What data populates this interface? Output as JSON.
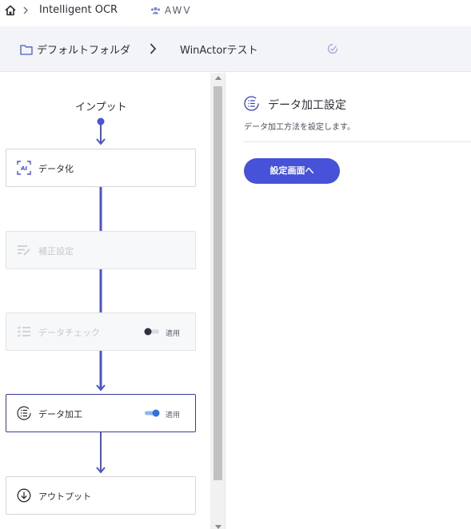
{
  "topbar": {
    "app_name": "Intelligent OCR",
    "org_name": "AWV"
  },
  "breadcrumb": {
    "folder": "デフォルトフォルダ",
    "project": "WinActorテスト"
  },
  "flow": {
    "input_label": "インプット",
    "nodes": [
      {
        "label": "データ化",
        "icon": "ai-scan-icon",
        "state": "enabled"
      },
      {
        "label": "補正設定",
        "icon": "edit-lines-icon",
        "state": "disabled"
      },
      {
        "label": "データチェック",
        "icon": "checklist-icon",
        "state": "disabled",
        "toggle_label": "適用",
        "toggle_on": false
      },
      {
        "label": "データ加工",
        "icon": "list-circle-icon",
        "state": "active",
        "toggle_label": "適用",
        "toggle_on": true
      },
      {
        "label": "アウトプット",
        "icon": "download-circle-icon",
        "state": "enabled"
      }
    ]
  },
  "detail": {
    "title": "データ加工設定",
    "description": "データ加工方法を設定します。",
    "button_label": "設定画面へ"
  },
  "colors": {
    "accent": "#4652d8",
    "flow_line": "#4a52d6",
    "active_border": "#3a3f9a"
  }
}
